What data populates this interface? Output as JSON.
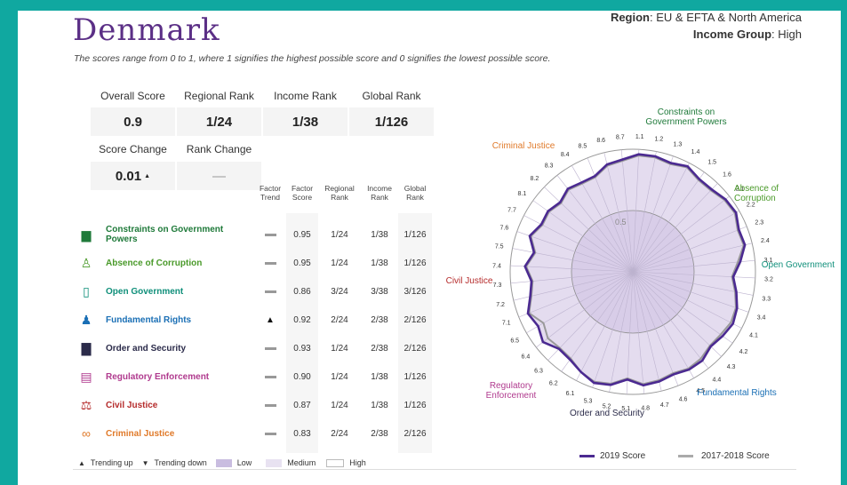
{
  "header": {
    "title": "Denmark",
    "region_label": "Region",
    "region_value": "EU & EFTA & North America",
    "income_label": "Income Group",
    "income_value": "High",
    "note": "The scores range from 0 to 1, where 1 signifies the highest possible score and 0 signifies the lowest possible score."
  },
  "summary": {
    "overall_label": "Overall Score",
    "regional_label": "Regional Rank",
    "income_label": "Income Rank",
    "global_label": "Global Rank",
    "overall": "0.9",
    "regional": "1/24",
    "income": "1/38",
    "global": "1/126",
    "score_change_label": "Score Change",
    "rank_change_label": "Rank Change",
    "score_change": "0.01",
    "score_change_arrow": "▲",
    "rank_change": "—"
  },
  "table": {
    "headers": {
      "trend": "Factor Trend",
      "score": "Factor Score",
      "regional": "Regional Rank",
      "income": "Income Rank",
      "global": "Global Rank"
    },
    "rows": [
      {
        "name": "Constraints on Government Powers",
        "icon": "building-icon",
        "color": "#1f7a3a",
        "trend": "flat",
        "score": "0.95",
        "regional": "1/24",
        "income": "1/38",
        "global": "1/126"
      },
      {
        "name": "Absence of Corruption",
        "icon": "money-bag-icon",
        "color": "#4a9a2a",
        "trend": "flat",
        "score": "0.95",
        "regional": "1/24",
        "income": "1/38",
        "global": "1/126"
      },
      {
        "name": "Open Government",
        "icon": "door-icon",
        "color": "#0f8f7a",
        "trend": "flat",
        "score": "0.86",
        "regional": "3/24",
        "income": "3/38",
        "global": "3/126"
      },
      {
        "name": "Fundamental Rights",
        "icon": "people-icon",
        "color": "#1a6fb5",
        "trend": "up",
        "score": "0.92",
        "regional": "2/24",
        "income": "2/38",
        "global": "2/126"
      },
      {
        "name": "Order and Security",
        "icon": "lock-icon",
        "color": "#2b2b4a",
        "trend": "flat",
        "score": "0.93",
        "regional": "1/24",
        "income": "2/38",
        "global": "2/126"
      },
      {
        "name": "Regulatory Enforcement",
        "icon": "document-icon",
        "color": "#b03a8e",
        "trend": "flat",
        "score": "0.90",
        "regional": "1/24",
        "income": "1/38",
        "global": "1/126"
      },
      {
        "name": "Civil Justice",
        "icon": "scales-icon",
        "color": "#b52b2b",
        "trend": "flat",
        "score": "0.87",
        "regional": "1/24",
        "income": "1/38",
        "global": "1/126"
      },
      {
        "name": "Criminal Justice",
        "icon": "handcuffs-icon",
        "color": "#e07a2a",
        "trend": "flat",
        "score": "0.83",
        "regional": "2/24",
        "income": "2/38",
        "global": "2/126"
      }
    ]
  },
  "legend": {
    "up": "Trending up",
    "down": "Trending down",
    "low": "Low",
    "medium": "Medium",
    "high": "High"
  },
  "chart_data": {
    "type": "radar",
    "gridline_label": "0.5",
    "range": [
      0,
      1
    ],
    "axes": [
      "1.1",
      "1.2",
      "1.3",
      "1.4",
      "1.5",
      "1.6",
      "2.1",
      "2.2",
      "2.3",
      "2.4",
      "3.1",
      "3.2",
      "3.3",
      "3.4",
      "4.1",
      "4.2",
      "4.3",
      "4.4",
      "4.5",
      "4.6",
      "4.7",
      "4.8",
      "5.1",
      "5.2",
      "5.3",
      "6.1",
      "6.2",
      "6.3",
      "6.4",
      "6.5",
      "7.1",
      "7.2",
      "7.3",
      "7.4",
      "7.5",
      "7.6",
      "7.7",
      "8.1",
      "8.2",
      "8.3",
      "8.4",
      "8.5",
      "8.6",
      "8.7"
    ],
    "groups": [
      {
        "label": "Constraints on Government Powers",
        "color": "#1f7a3a"
      },
      {
        "label": "Absence of Corruption",
        "color": "#4a9a2a"
      },
      {
        "label": "Open Government",
        "color": "#0f8f7a"
      },
      {
        "label": "Fundamental Rights",
        "color": "#1a6fb5"
      },
      {
        "label": "Order and Security",
        "color": "#2b2b4a"
      },
      {
        "label": "Regulatory Enforcement",
        "color": "#b03a8e"
      },
      {
        "label": "Civil Justice",
        "color": "#b52b2b"
      },
      {
        "label": "Criminal Justice",
        "color": "#e07a2a"
      }
    ],
    "series": [
      {
        "name": "2019 Score",
        "color": "#4b2a91",
        "values": [
          0.96,
          0.96,
          0.94,
          0.97,
          0.93,
          0.93,
          0.96,
          0.97,
          0.93,
          0.94,
          0.88,
          0.82,
          0.86,
          0.9,
          0.92,
          0.9,
          0.88,
          0.92,
          0.92,
          0.9,
          0.92,
          0.93,
          0.88,
          0.94,
          0.96,
          0.92,
          0.88,
          0.87,
          0.93,
          0.89,
          0.92,
          0.86,
          0.83,
          0.88,
          0.82,
          0.89,
          0.84,
          0.85,
          0.82,
          0.86,
          0.84,
          0.84,
          0.9,
          0.92
        ]
      },
      {
        "name": "2017-2018 Score",
        "color": "#999999",
        "values": [
          0.95,
          0.95,
          0.93,
          0.96,
          0.92,
          0.92,
          0.95,
          0.96,
          0.92,
          0.93,
          0.86,
          0.81,
          0.85,
          0.89,
          0.9,
          0.88,
          0.87,
          0.9,
          0.91,
          0.89,
          0.91,
          0.92,
          0.87,
          0.93,
          0.95,
          0.92,
          0.87,
          0.86,
          0.88,
          0.84,
          0.91,
          0.85,
          0.82,
          0.87,
          0.81,
          0.88,
          0.83,
          0.84,
          0.81,
          0.85,
          0.83,
          0.83,
          0.89,
          0.91
        ]
      }
    ]
  }
}
